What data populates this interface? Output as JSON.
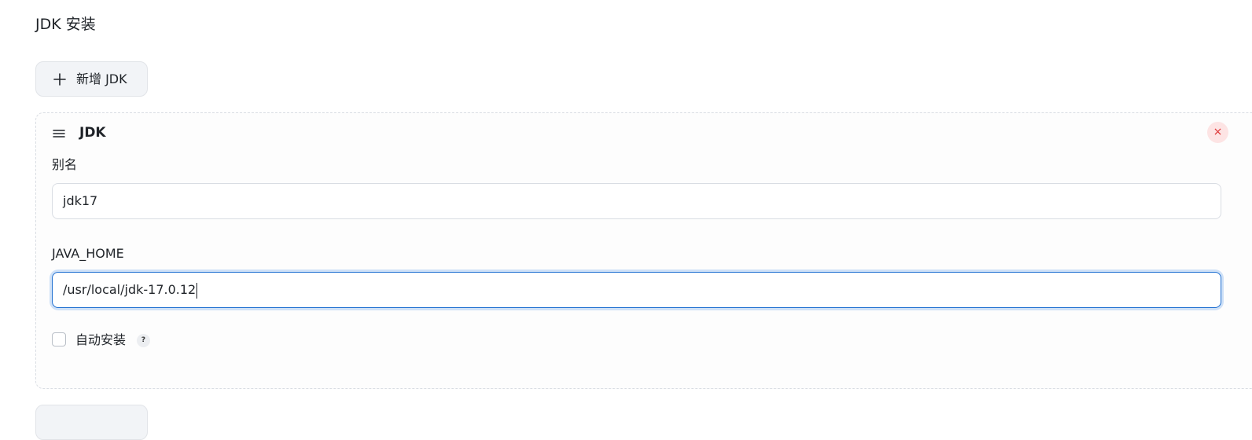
{
  "section": {
    "title": "JDK 安装"
  },
  "add_button": {
    "label": "新增 JDK",
    "icon": "plus-icon"
  },
  "card": {
    "title": "JDK",
    "drag_icon": "drag-handle-icon",
    "close_icon": "close-icon",
    "close_symbol": "×",
    "fields": {
      "alias": {
        "label": "别名",
        "value": "jdk17"
      },
      "java_home": {
        "label": "JAVA_HOME",
        "value": "/usr/local/jdk-17.0.12"
      }
    },
    "auto_install": {
      "label": "自动安装",
      "checked": false,
      "help_symbol": "?"
    }
  },
  "colors": {
    "focus_border": "#1f6fd1",
    "close_bg": "#fde4e4",
    "close_fg": "#dd3333"
  }
}
